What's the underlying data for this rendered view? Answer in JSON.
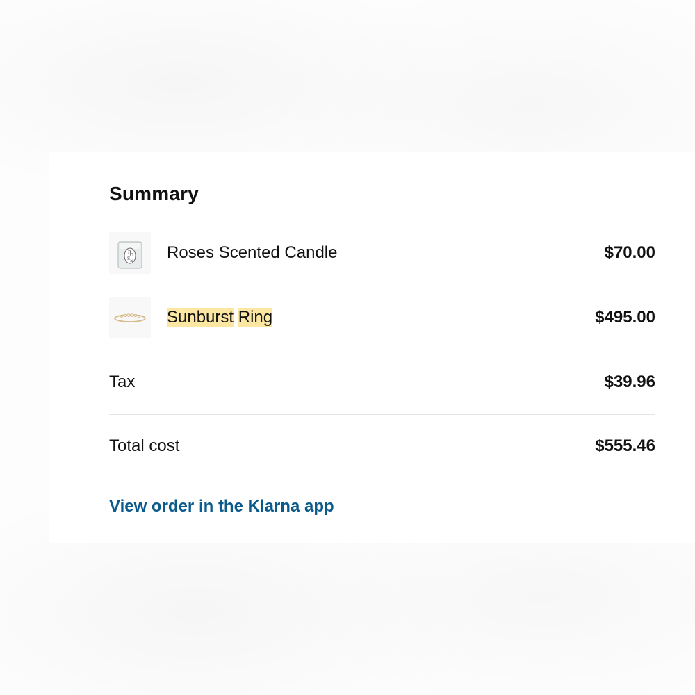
{
  "summary": {
    "title": "Summary"
  },
  "items": [
    {
      "name": "Roses Scented Candle",
      "price": "$70.00",
      "thumbnail_icon": "candle-icon"
    },
    {
      "name_parts": [
        "Sunburst",
        "Ring"
      ],
      "price": "$495.00",
      "thumbnail_icon": "ring-icon"
    }
  ],
  "tax": {
    "label": "Tax",
    "value": "$39.96"
  },
  "total": {
    "label": "Total cost",
    "value": "$555.46"
  },
  "link": {
    "label": "View order in the Klarna app",
    "color": "#0b5a8c"
  },
  "highlight_color": "#fbe6a2"
}
